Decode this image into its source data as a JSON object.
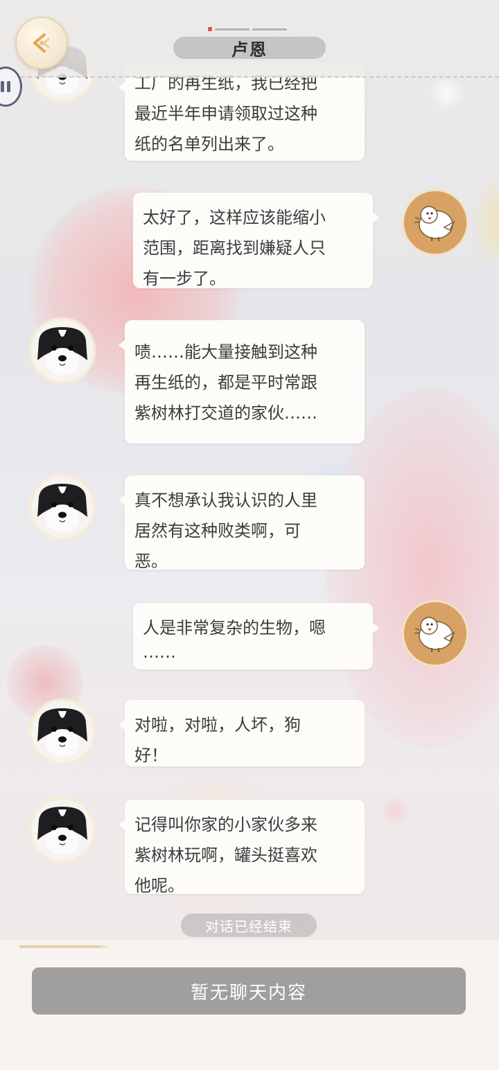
{
  "header": {
    "title": "卢恩"
  },
  "messages": [
    {
      "side": "left",
      "avatar": "dog-avatar",
      "lines": [
        "工厂的再生纸，我已经把",
        "最近半年申请领取过这种",
        "纸的名单列出来了。"
      ]
    },
    {
      "side": "right",
      "avatar": "bird-avatar",
      "lines": [
        "太好了，这样应该能缩小",
        "范围，距离找到嫌疑人只",
        "有一步了。"
      ]
    },
    {
      "side": "left",
      "avatar": "dog-avatar",
      "lines": [
        "啧……能大量接触到这种",
        "再生纸的，都是平时常跟",
        "紫树林打交道的家伙……"
      ]
    },
    {
      "side": "left",
      "avatar": "dog-avatar",
      "lines": [
        "真不想承认我认识的人里",
        "居然有这种败类啊，可",
        "恶。"
      ]
    },
    {
      "side": "right",
      "avatar": "bird-avatar",
      "lines": [
        "人是非常复杂的生物，嗯",
        "……"
      ]
    },
    {
      "side": "left",
      "avatar": "dog-avatar",
      "lines": [
        "对啦，对啦，人坏，狗",
        "好！"
      ]
    },
    {
      "side": "left",
      "avatar": "dog-avatar",
      "lines": [
        "记得叫你家的小家伙多来",
        "紫树林玩啊，罐头挺喜欢",
        "他呢。"
      ]
    }
  ],
  "status": {
    "conversation_ended": "对话已经结束"
  },
  "input": {
    "placeholder": "暂无聊天内容"
  },
  "colors": {
    "bubble": "#fdfcf9",
    "text": "#3c3c3c",
    "input_bar": "#a09f9d",
    "bird_avatar": "#d7a264"
  }
}
